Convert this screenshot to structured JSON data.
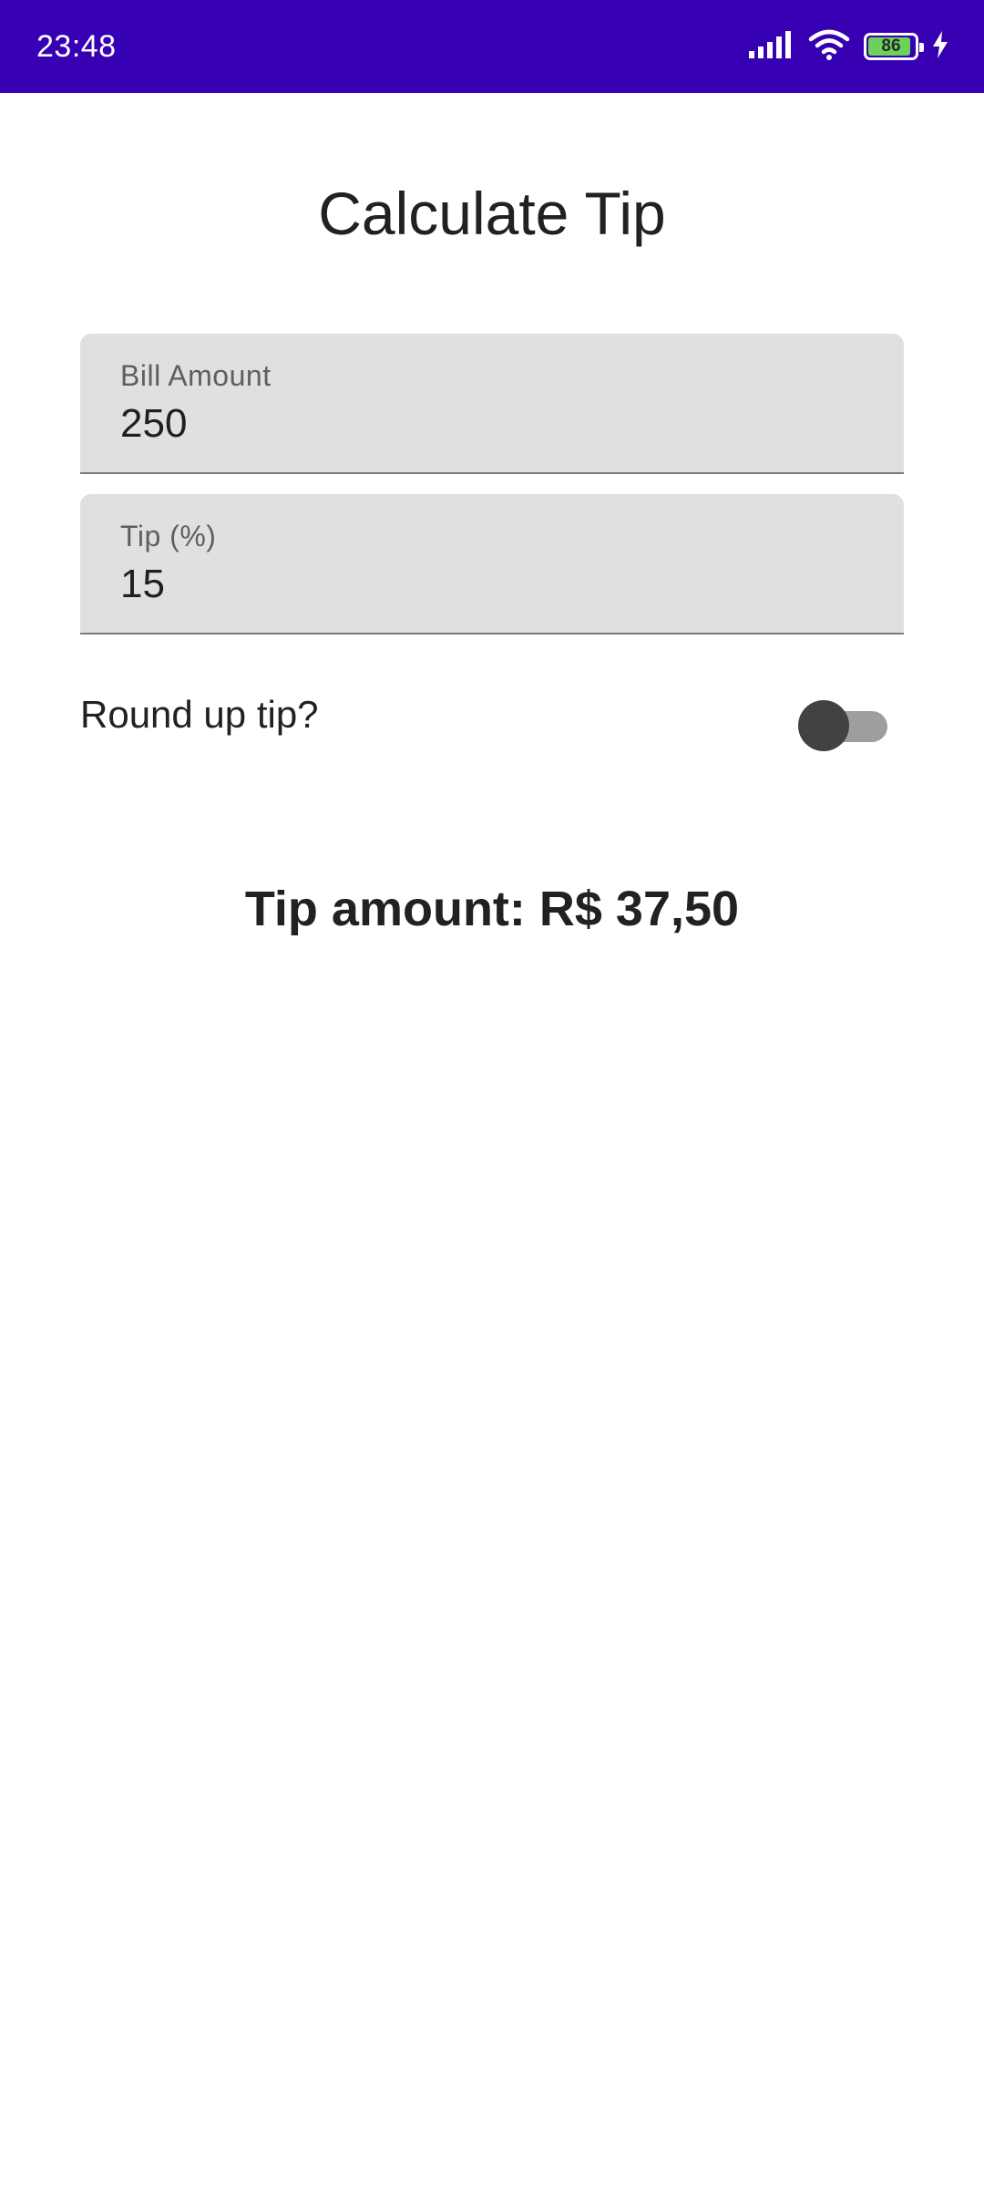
{
  "status_bar": {
    "time": "23:48",
    "battery_level": "86",
    "icons": [
      "signal-icon",
      "wifi-icon",
      "battery-icon",
      "charging-icon"
    ],
    "background_color": "#3700b3"
  },
  "page": {
    "title": "Calculate Tip"
  },
  "bill_field": {
    "label": "Bill Amount",
    "value": "250"
  },
  "tip_field": {
    "label": "Tip (%)",
    "value": "15"
  },
  "round_up": {
    "label": "Round up tip?",
    "checked": false
  },
  "result": {
    "text": "Tip amount: R$ 37,50"
  }
}
